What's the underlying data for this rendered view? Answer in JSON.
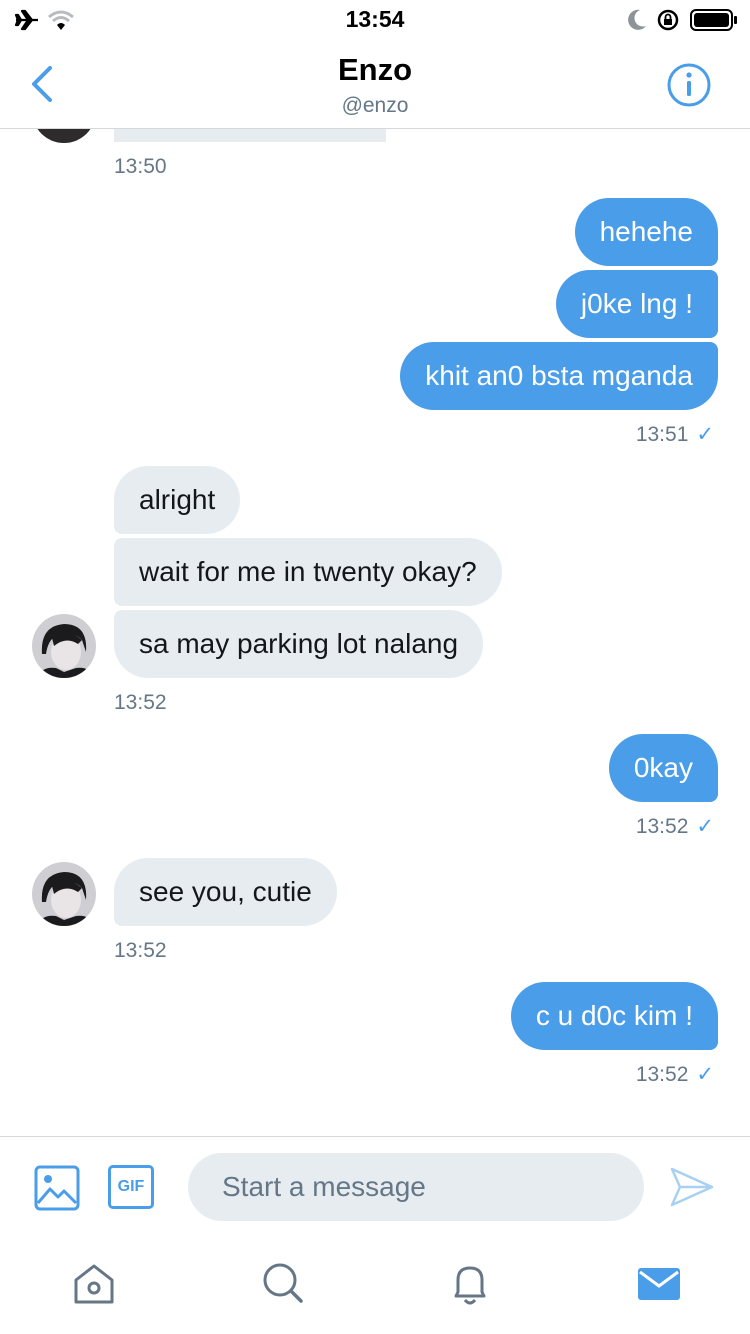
{
  "status": {
    "time": "13:54"
  },
  "header": {
    "name": "Enzo",
    "handle": "@enzo"
  },
  "messages": {
    "ts1": "13:50",
    "m1": "hehehe",
    "m2": "j0ke lng !",
    "m3": "khit an0 bsta mganda",
    "ts2": "13:51",
    "m4": "alright",
    "m5": "wait for me in twenty okay?",
    "m6": "sa may parking lot nalang",
    "ts3": "13:52",
    "m7": "0kay",
    "ts4": "13:52",
    "m8": "see you, cutie",
    "ts5": "13:52",
    "m9": "c u d0c kim !",
    "ts6": "13:52"
  },
  "composer": {
    "placeholder": "Start a message",
    "gif_label": "GIF"
  },
  "colors": {
    "accent": "#4a9de8",
    "incoming_bubble": "#e6ecf0",
    "muted": "#657786"
  },
  "icons": [
    "airplane-icon",
    "wifi-icon",
    "moon-icon",
    "rotation-lock-icon",
    "battery-icon",
    "back-chevron-icon",
    "info-icon",
    "image-icon",
    "gif-icon",
    "send-icon",
    "home-icon",
    "search-icon",
    "bell-icon",
    "mail-icon"
  ]
}
